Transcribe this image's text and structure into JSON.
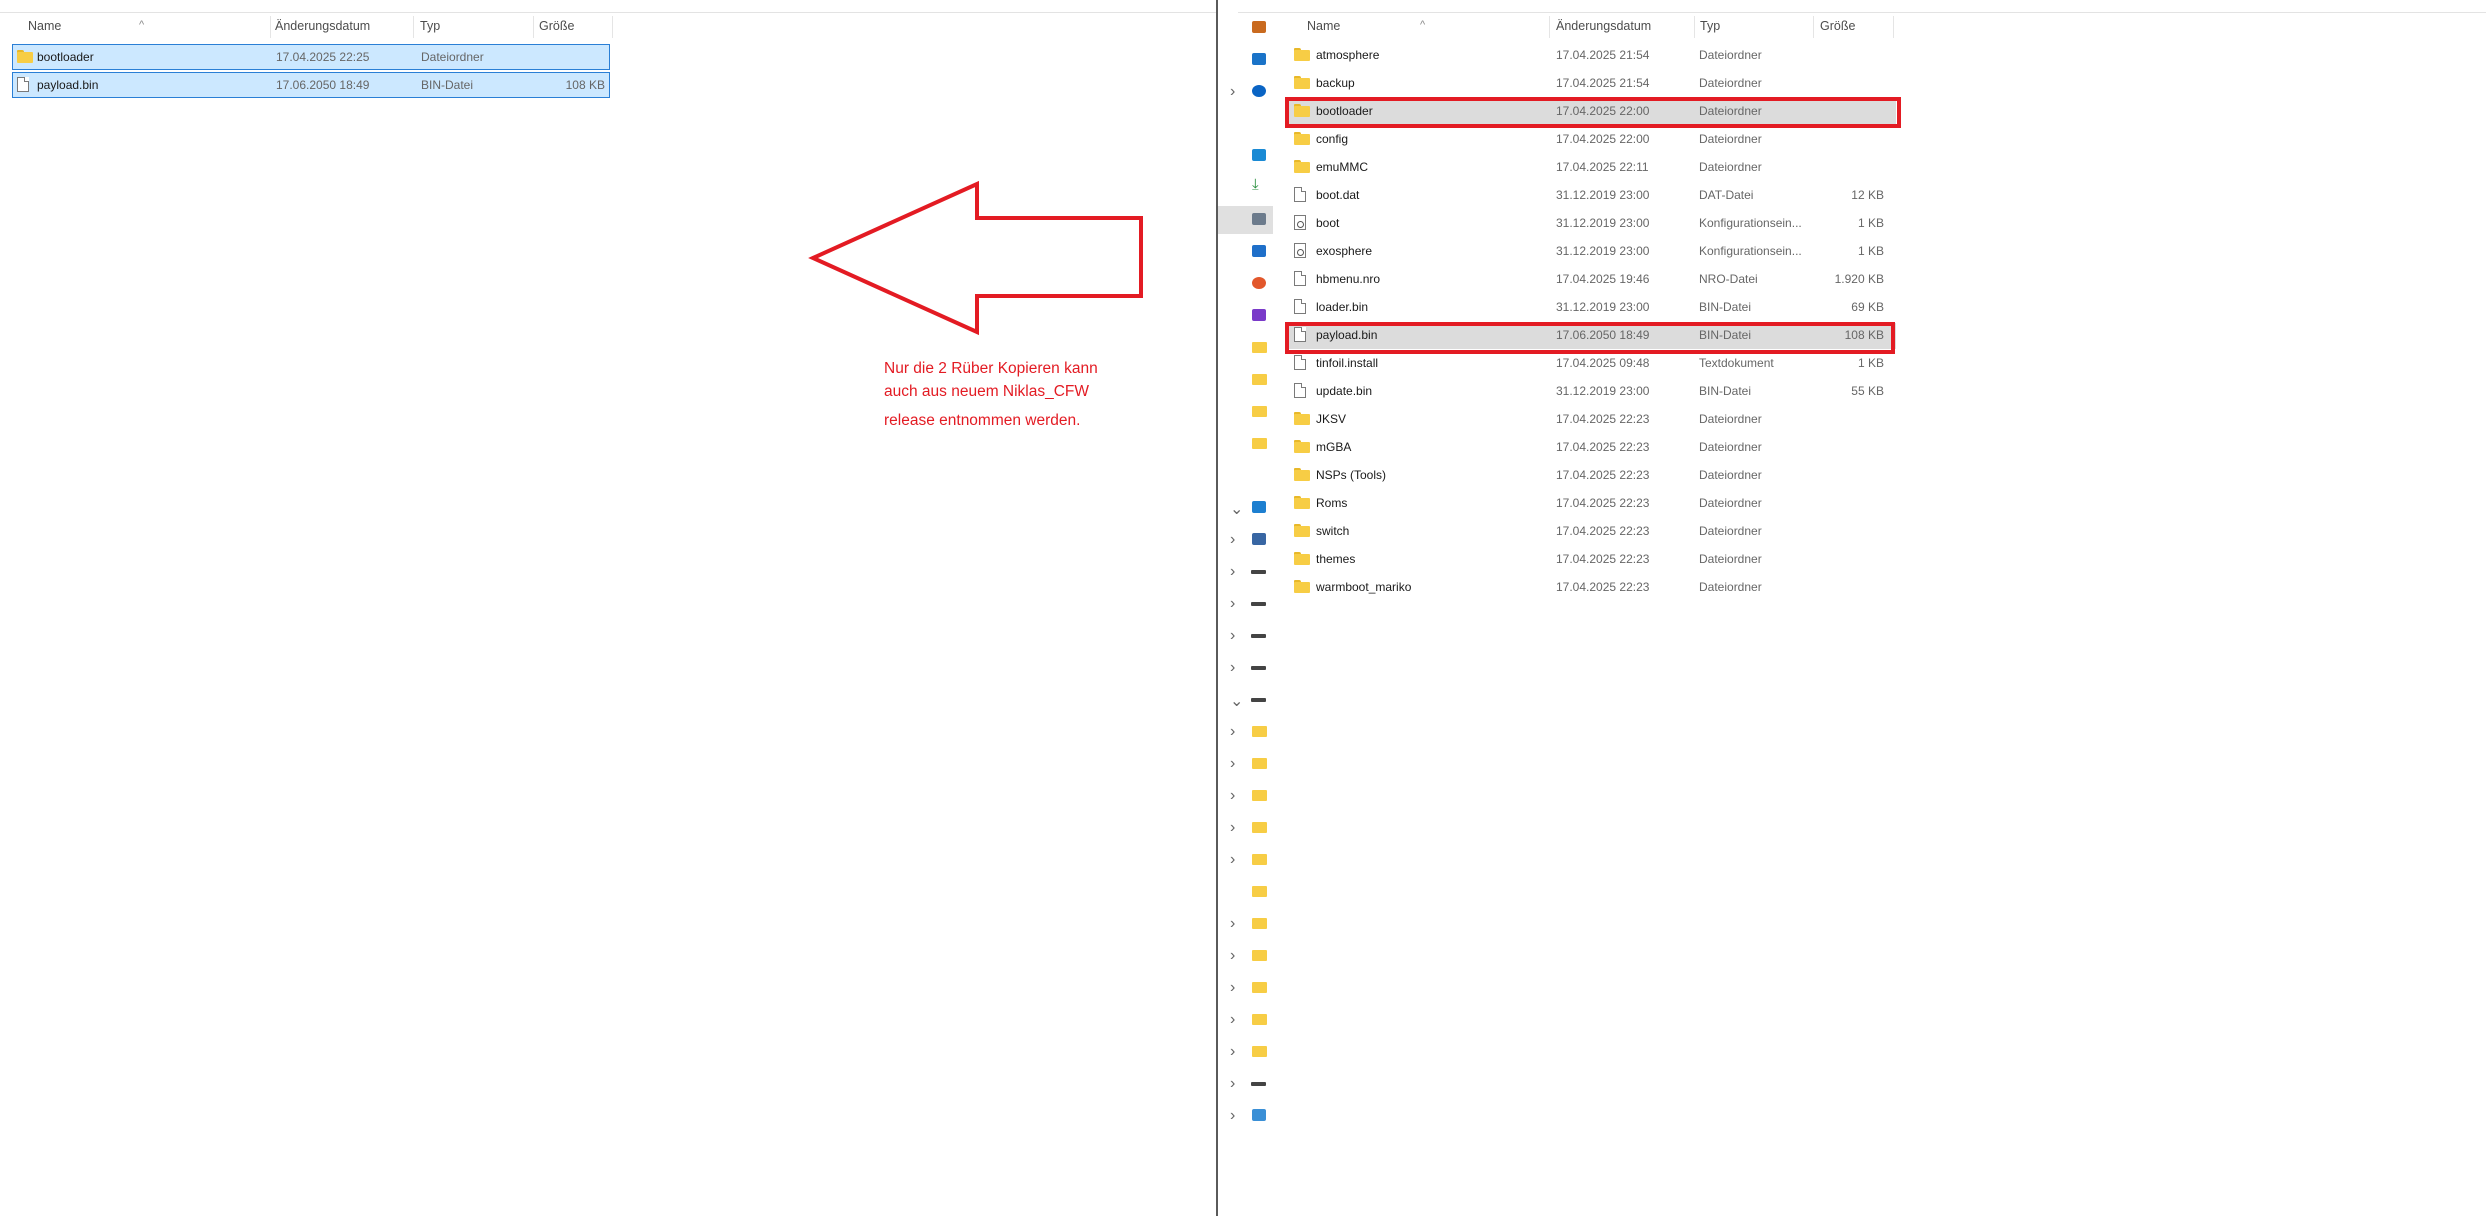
{
  "columns": {
    "name": "Name",
    "date": "Änderungsdatum",
    "type": "Typ",
    "size": "Größe",
    "sort_caret": "^"
  },
  "left_pane": {
    "files": [
      {
        "name": "bootloader",
        "date": "17.04.2025 22:25",
        "type": "Dateiordner",
        "size": "",
        "icon": "folder-icon"
      },
      {
        "name": "payload.bin",
        "date": "17.06.2050 18:49",
        "type": "BIN-Datei",
        "size": "108 KB",
        "icon": "file-icon"
      }
    ]
  },
  "right_pane": {
    "files": [
      {
        "name": "atmosphere",
        "date": "17.04.2025 21:54",
        "type": "Dateiordner",
        "size": "",
        "icon": "folder-icon"
      },
      {
        "name": "backup",
        "date": "17.04.2025 21:54",
        "type": "Dateiordner",
        "size": "",
        "icon": "folder-icon"
      },
      {
        "name": "bootloader",
        "date": "17.04.2025 22:00",
        "type": "Dateiordner",
        "size": "",
        "icon": "folder-icon"
      },
      {
        "name": "config",
        "date": "17.04.2025 22:00",
        "type": "Dateiordner",
        "size": "",
        "icon": "folder-icon"
      },
      {
        "name": "emuMMC",
        "date": "17.04.2025 22:11",
        "type": "Dateiordner",
        "size": "",
        "icon": "folder-icon"
      },
      {
        "name": "boot.dat",
        "date": "31.12.2019 23:00",
        "type": "DAT-Datei",
        "size": "12 KB",
        "icon": "file-icon"
      },
      {
        "name": "boot",
        "date": "31.12.2019 23:00",
        "type": "Konfigurationsein...",
        "size": "1 KB",
        "icon": "settings-file-icon"
      },
      {
        "name": "exosphere",
        "date": "31.12.2019 23:00",
        "type": "Konfigurationsein...",
        "size": "1 KB",
        "icon": "settings-file-icon"
      },
      {
        "name": "hbmenu.nro",
        "date": "17.04.2025 19:46",
        "type": "NRO-Datei",
        "size": "1.920 KB",
        "icon": "file-icon"
      },
      {
        "name": "loader.bin",
        "date": "31.12.2019 23:00",
        "type": "BIN-Datei",
        "size": "69 KB",
        "icon": "file-icon"
      },
      {
        "name": "payload.bin",
        "date": "17.06.2050 18:49",
        "type": "BIN-Datei",
        "size": "108 KB",
        "icon": "file-icon"
      },
      {
        "name": "tinfoil.install",
        "date": "17.04.2025 09:48",
        "type": "Textdokument",
        "size": "1 KB",
        "icon": "file-icon"
      },
      {
        "name": "update.bin",
        "date": "31.12.2019 23:00",
        "type": "BIN-Datei",
        "size": "55 KB",
        "icon": "file-icon"
      },
      {
        "name": "JKSV",
        "date": "17.04.2025 22:23",
        "type": "Dateiordner",
        "size": "",
        "icon": "folder-icon"
      },
      {
        "name": "mGBA",
        "date": "17.04.2025 22:23",
        "type": "Dateiordner",
        "size": "",
        "icon": "folder-icon"
      },
      {
        "name": "NSPs (Tools)",
        "date": "17.04.2025 22:23",
        "type": "Dateiordner",
        "size": "",
        "icon": "folder-icon"
      },
      {
        "name": "Roms",
        "date": "17.04.2025 22:23",
        "type": "Dateiordner",
        "size": "",
        "icon": "folder-icon"
      },
      {
        "name": "switch",
        "date": "17.04.2025 22:23",
        "type": "Dateiordner",
        "size": "",
        "icon": "folder-icon"
      },
      {
        "name": "themes",
        "date": "17.04.2025 22:23",
        "type": "Dateiordner",
        "size": "",
        "icon": "folder-icon"
      },
      {
        "name": "warmboot_mariko",
        "date": "17.04.2025 22:23",
        "type": "Dateiordner",
        "size": "",
        "icon": "folder-icon"
      }
    ]
  },
  "annotation": {
    "lines": [
      "Nur die 2 Rüber Kopieren kann",
      "auch aus neuem Niklas_CFW",
      "release entnommen werden."
    ],
    "color": "#e31b23"
  },
  "nav_icons": [
    "home-icon",
    "gallery-icon",
    "onedrive-icon",
    "desktop-icon",
    "downloads-icon",
    "documents-icon",
    "pictures-icon",
    "music-icon",
    "videos-icon",
    "folder-icon",
    "folder-icon",
    "folder-icon",
    "folder-icon",
    "this-pc-icon",
    "network-drive-icon",
    "drive-icon",
    "drive-icon",
    "drive-icon",
    "drive-icon",
    "drive-icon",
    "folder-icon",
    "folder-icon",
    "folder-icon",
    "folder-icon",
    "folder-icon",
    "folder-icon",
    "folder-icon",
    "folder-icon",
    "folder-icon",
    "folder-icon",
    "folder-icon",
    "drive-icon",
    "network-icon"
  ],
  "nav_chevrons": [
    "",
    "",
    ">",
    "",
    "",
    "",
    "",
    "",
    "",
    "",
    "",
    "",
    "",
    "v",
    ">",
    ">",
    ">",
    ">",
    ">",
    "v",
    ">",
    ">",
    ">",
    ">",
    ">",
    "",
    ">",
    ">",
    ">",
    ">",
    ">",
    ">",
    ">"
  ]
}
